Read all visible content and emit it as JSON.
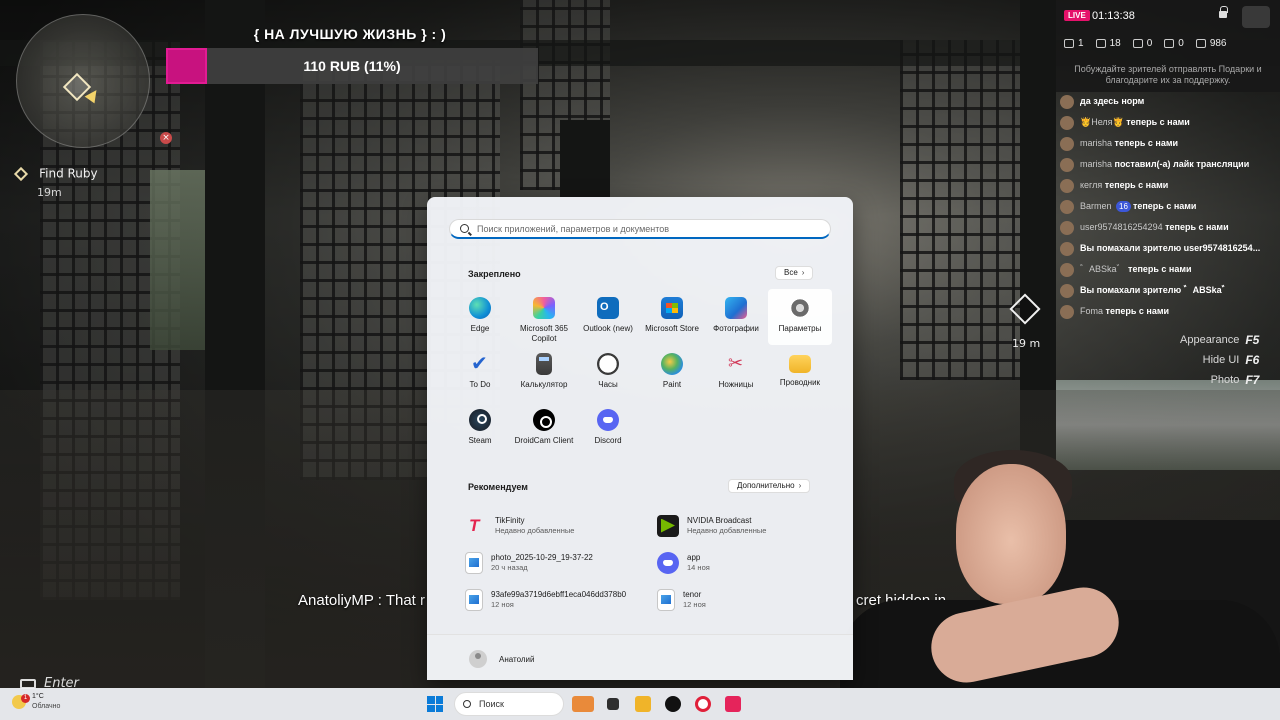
{
  "overlay": {
    "goal_title": "{ НА ЛУЧШУЮ ЖИЗНЬ } : )",
    "goal_text": "110 RUB (11%)",
    "goal_progress_percent": 11,
    "goal_color": "#c8127f"
  },
  "game": {
    "quest_title": "Find Ruby",
    "quest_distance": "19m",
    "marker_distance": "19 m",
    "hotkeys": [
      {
        "label": "Appearance",
        "key": "F5"
      },
      {
        "label": "Hide UI",
        "key": "F6"
      },
      {
        "label": "Photo",
        "key": "F7"
      }
    ],
    "subtitle_left": "AnatoliyMP : That r",
    "subtitle_right": "cret hidden in",
    "enter_hint": "Enter"
  },
  "stream": {
    "live_label": "LIVE",
    "live_time": "01:13:38",
    "stats": [
      "1",
      "18",
      "0",
      "0",
      "986"
    ],
    "hint": "Побуждайте зрителей отправлять Подарки и благодарите их за поддержку.",
    "chat": [
      {
        "user": "",
        "msg": "да здесь норм"
      },
      {
        "user": "🫅Неля🫅",
        "msg": "теперь с нами"
      },
      {
        "user": "marisha",
        "msg": "теперь с нами"
      },
      {
        "user": "marisha",
        "msg": "поставил(-а) лайк трансляции"
      },
      {
        "user": "кегля",
        "msg": "теперь с нами"
      },
      {
        "user": "Barmen",
        "badge": "16",
        "msg": "теперь с нами"
      },
      {
        "user": "user9574816254294",
        "msg": "теперь с нами"
      },
      {
        "user": "",
        "msg": "Вы помахали зрителю user9574816254..."
      },
      {
        "user": "゛ABSka゛",
        "msg": "теперь с нами"
      },
      {
        "user": "",
        "msg": "Вы помахали зрителю ゛ABSka゛"
      },
      {
        "user": "Foma",
        "msg": "теперь с нами"
      }
    ]
  },
  "start_menu": {
    "search_placeholder": "Поиск приложений, параметров и документов",
    "pinned_title": "Закреплено",
    "all_button": "Все",
    "pinned": [
      {
        "label": "Edge",
        "icon": "edge-icon"
      },
      {
        "label": "Microsoft 365 Copilot",
        "icon": "m365-icon"
      },
      {
        "label": "Outlook (new)",
        "icon": "outlook-icon"
      },
      {
        "label": "Microsoft Store",
        "icon": "store-icon"
      },
      {
        "label": "Фотографии",
        "icon": "photos-icon"
      },
      {
        "label": "Параметры",
        "icon": "settings-gear-icon"
      },
      {
        "label": "To Do",
        "icon": "todo-icon"
      },
      {
        "label": "Калькулятор",
        "icon": "calculator-icon"
      },
      {
        "label": "Часы",
        "icon": "clock-icon"
      },
      {
        "label": "Paint",
        "icon": "paint-icon"
      },
      {
        "label": "Ножницы",
        "icon": "snipping-tool-icon"
      },
      {
        "label": "Проводник",
        "icon": "folder-icon"
      },
      {
        "label": "Steam",
        "icon": "steam-icon"
      },
      {
        "label": "DroidCam Client",
        "icon": "droidcam-icon"
      },
      {
        "label": "Discord",
        "icon": "discord-icon"
      }
    ],
    "recommended_title": "Рекомендуем",
    "more_button": "Дополнительно",
    "recommended": [
      {
        "name": "TikFinity",
        "sub": "Недавно добавленные",
        "icon": "tikfinity-icon"
      },
      {
        "name": "NVIDIA Broadcast",
        "sub": "Недавно добавленные",
        "icon": "nvidia-icon"
      },
      {
        "name": "photo_2025-10-29_19-37-22",
        "sub": "20 ч назад",
        "icon": "image-file-icon"
      },
      {
        "name": "app",
        "sub": "14 ноя",
        "icon": "discord-icon"
      },
      {
        "name": "93afe99a3719d6ebff1eca046dd378b0",
        "sub": "12 ноя",
        "icon": "image-file-icon"
      },
      {
        "name": "tenor",
        "sub": "12 ноя",
        "icon": "image-file-icon"
      }
    ],
    "user_name": "Анатолий"
  },
  "taskbar": {
    "weather_temp": "1°C",
    "weather_desc": "Облачно",
    "weather_badge": "1",
    "search_label": "Поиск"
  }
}
